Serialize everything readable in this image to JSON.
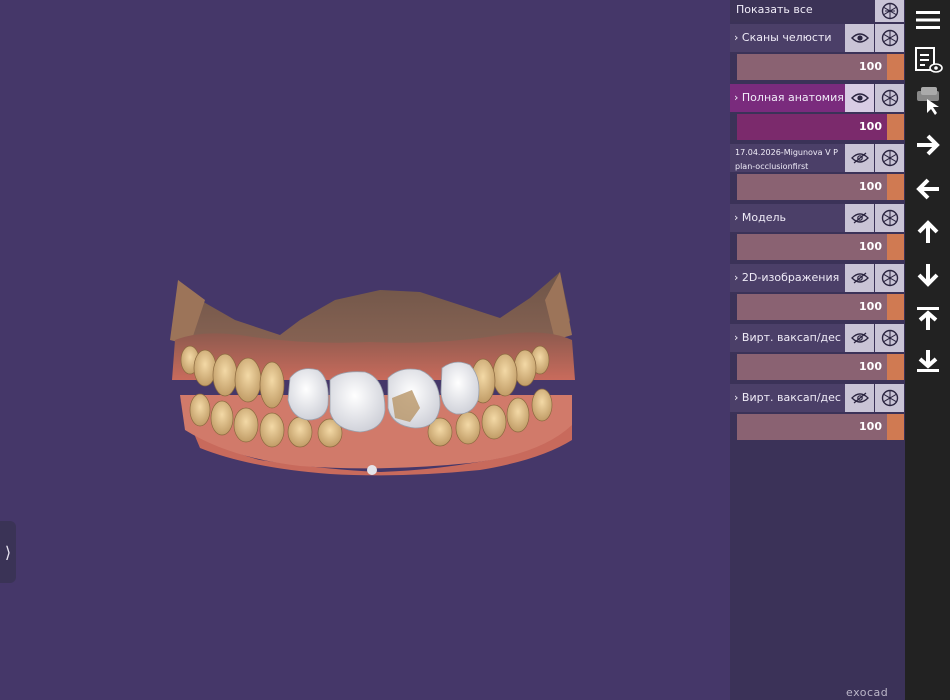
{
  "panel": {
    "show_all": "Показать все",
    "groups": [
      {
        "label": "Сканы челюсти",
        "value": "100",
        "eye": "eye-icon",
        "selected": false
      },
      {
        "label": "Полная анатомия",
        "value": "100",
        "eye": "eye-icon",
        "selected": true
      },
      {
        "label_line1": "17.04.2026-Migunova V P",
        "label_line2": "plan-occlusionfirst",
        "value": "100",
        "eye": "eye-half-icon",
        "selected": false
      },
      {
        "label": "Модель",
        "value": "100",
        "eye": "eye-half-icon",
        "selected": false
      },
      {
        "label": "2D-изображения",
        "value": "100",
        "eye": "eye-half-icon",
        "selected": false
      },
      {
        "label": "Вирт. ваксап/дес",
        "value": "100",
        "eye": "eye-half-icon",
        "selected": false
      },
      {
        "label": "Вирт. ваксап/дес",
        "value": "100",
        "eye": "eye-half-icon",
        "selected": false
      }
    ]
  },
  "toolbar": {
    "items": [
      "menu-icon",
      "visibility-list-icon",
      "hand-click-icon",
      "arrow-right-icon",
      "arrow-left-icon",
      "arrow-up-icon",
      "arrow-down-icon",
      "view-top-icon",
      "view-bottom-icon"
    ]
  },
  "brand": "exocad",
  "colors": {
    "background": "#453769",
    "panel": "#3b3258",
    "selected": "#7a2b7d",
    "slider": "#8a6272",
    "accent": "#d07a52",
    "toolbar": "#222222"
  }
}
